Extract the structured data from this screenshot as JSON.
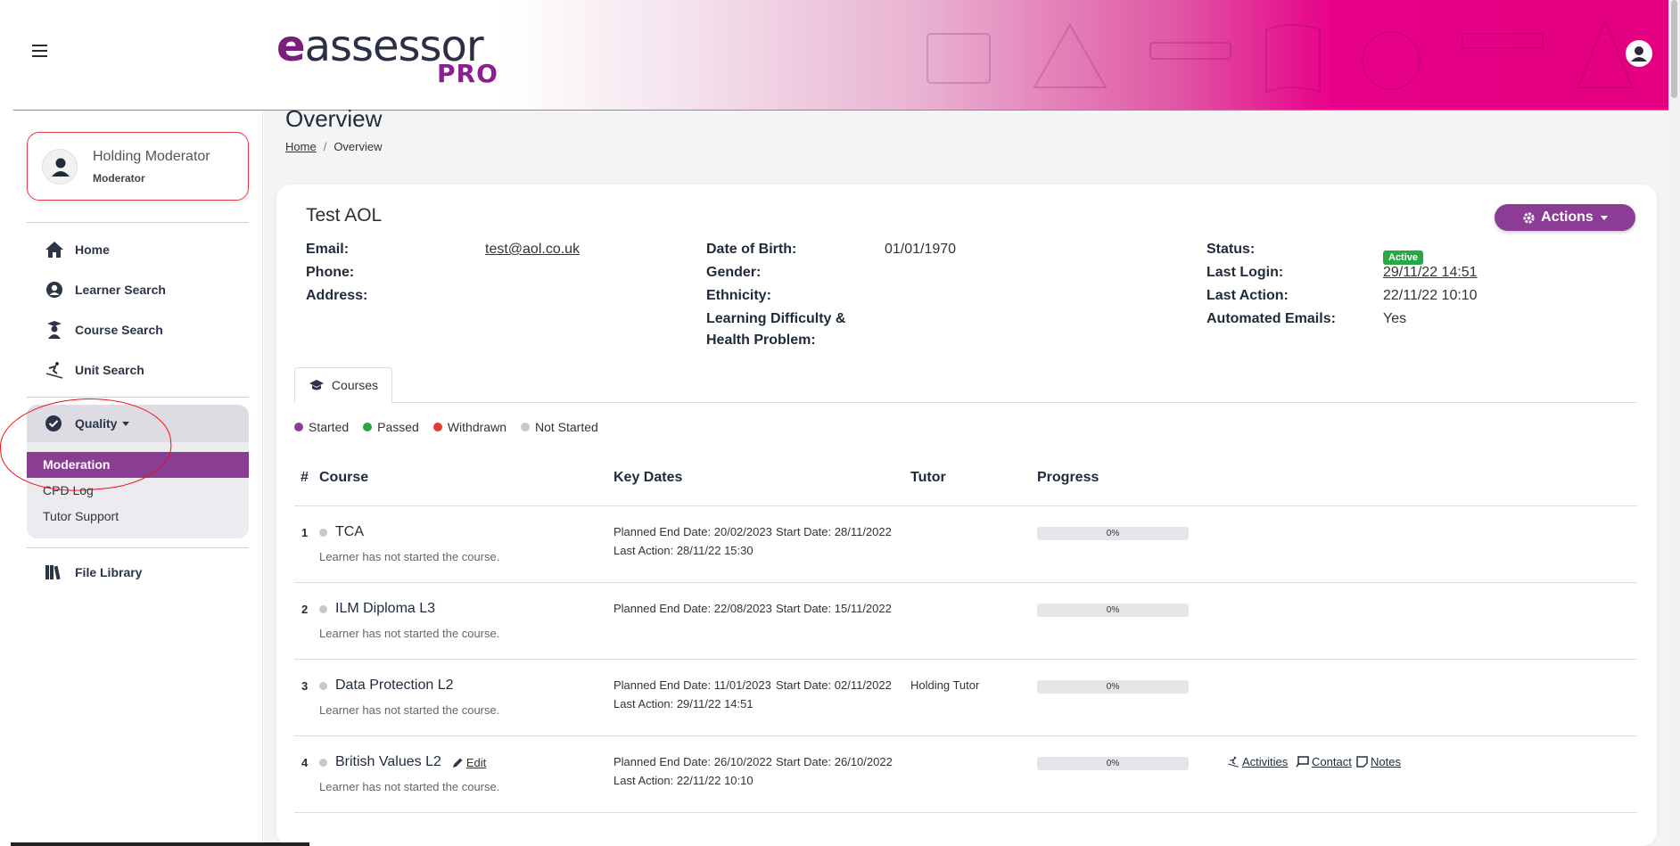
{
  "brand": {
    "logo_main": "eassessor",
    "logo_pro": "PRO"
  },
  "sidebar": {
    "profile": {
      "name": "Holding Moderator",
      "role": "Moderator"
    },
    "items": [
      {
        "label": "Home",
        "icon": "home-icon"
      },
      {
        "label": "Learner Search",
        "icon": "user-circle-icon"
      },
      {
        "label": "Course Search",
        "icon": "graduate-icon"
      },
      {
        "label": "Unit Search",
        "icon": "skier-icon"
      }
    ],
    "quality": {
      "label": "Quality",
      "sub": [
        "Moderation",
        "CPD Log",
        "Tutor Support"
      ]
    },
    "file_library": "File Library"
  },
  "main": {
    "title": "Overview",
    "breadcrumb": {
      "home": "Home",
      "current": "Overview",
      "separator": "/"
    },
    "learner": {
      "name": "Test AOL",
      "actions_label": "Actions",
      "fields": {
        "email_label": "Email:",
        "email_value": "test@aol.co.uk",
        "phone_label": "Phone:",
        "address_label": "Address:",
        "dob_label": "Date of Birth:",
        "dob_value": "01/01/1970",
        "gender_label": "Gender:",
        "ethnicity_label": "Ethnicity:",
        "ldhp_label_1": "Learning Difficulty &",
        "ldhp_label_2": "Health Problem:",
        "status_label": "Status:",
        "status_value": "Active",
        "last_login_label": "Last Login:",
        "last_login_value": "29/11/22 14:51",
        "last_action_label": "Last Action:",
        "last_action_value": "22/11/22 10:10",
        "auto_emails_label": "Automated Emails:",
        "auto_emails_value": "Yes"
      }
    },
    "tab": "Courses",
    "legend": [
      {
        "label": "Started",
        "color": "#8b3d95"
      },
      {
        "label": "Passed",
        "color": "#28a745"
      },
      {
        "label": "Withdrawn",
        "color": "#e53935"
      },
      {
        "label": "Not Started",
        "color": "#c8c8c8"
      }
    ],
    "table": {
      "headers": {
        "num": "#",
        "course": "Course",
        "key_dates": "Key Dates",
        "tutor": "Tutor",
        "progress": "Progress"
      },
      "rows": [
        {
          "num": "1",
          "course": "TCA",
          "sub": "Learner has not started the course.",
          "planned": "Planned End Date: 20/02/2023",
          "start": "Start Date: 28/11/2022",
          "last_action": "Last Action: 28/11/22 15:30",
          "tutor": "",
          "progress": "0%"
        },
        {
          "num": "2",
          "course": "ILM Diploma L3",
          "sub": "Learner has not started the course.",
          "planned": "Planned End Date: 22/08/2023",
          "start": "Start Date: 15/11/2022",
          "last_action": "",
          "tutor": "",
          "progress": "0%"
        },
        {
          "num": "3",
          "course": "Data Protection L2",
          "sub": "Learner has not started the course.",
          "planned": "Planned End Date: 11/01/2023",
          "start": "Start Date: 02/11/2022",
          "last_action": "Last Action: 29/11/22 14:51",
          "tutor": "Holding Tutor",
          "progress": "0%"
        },
        {
          "num": "4",
          "course": "British Values L2",
          "sub": "Learner has not started the course.",
          "planned": "Planned End Date: 26/10/2022",
          "start": "Start Date: 26/10/2022",
          "last_action": "Last Action: 22/11/22 10:10",
          "tutor": "",
          "progress": "0%",
          "edit": "Edit"
        }
      ],
      "row_actions": {
        "activities": "Activities",
        "contact": "Contact",
        "notes": "Notes"
      }
    }
  }
}
